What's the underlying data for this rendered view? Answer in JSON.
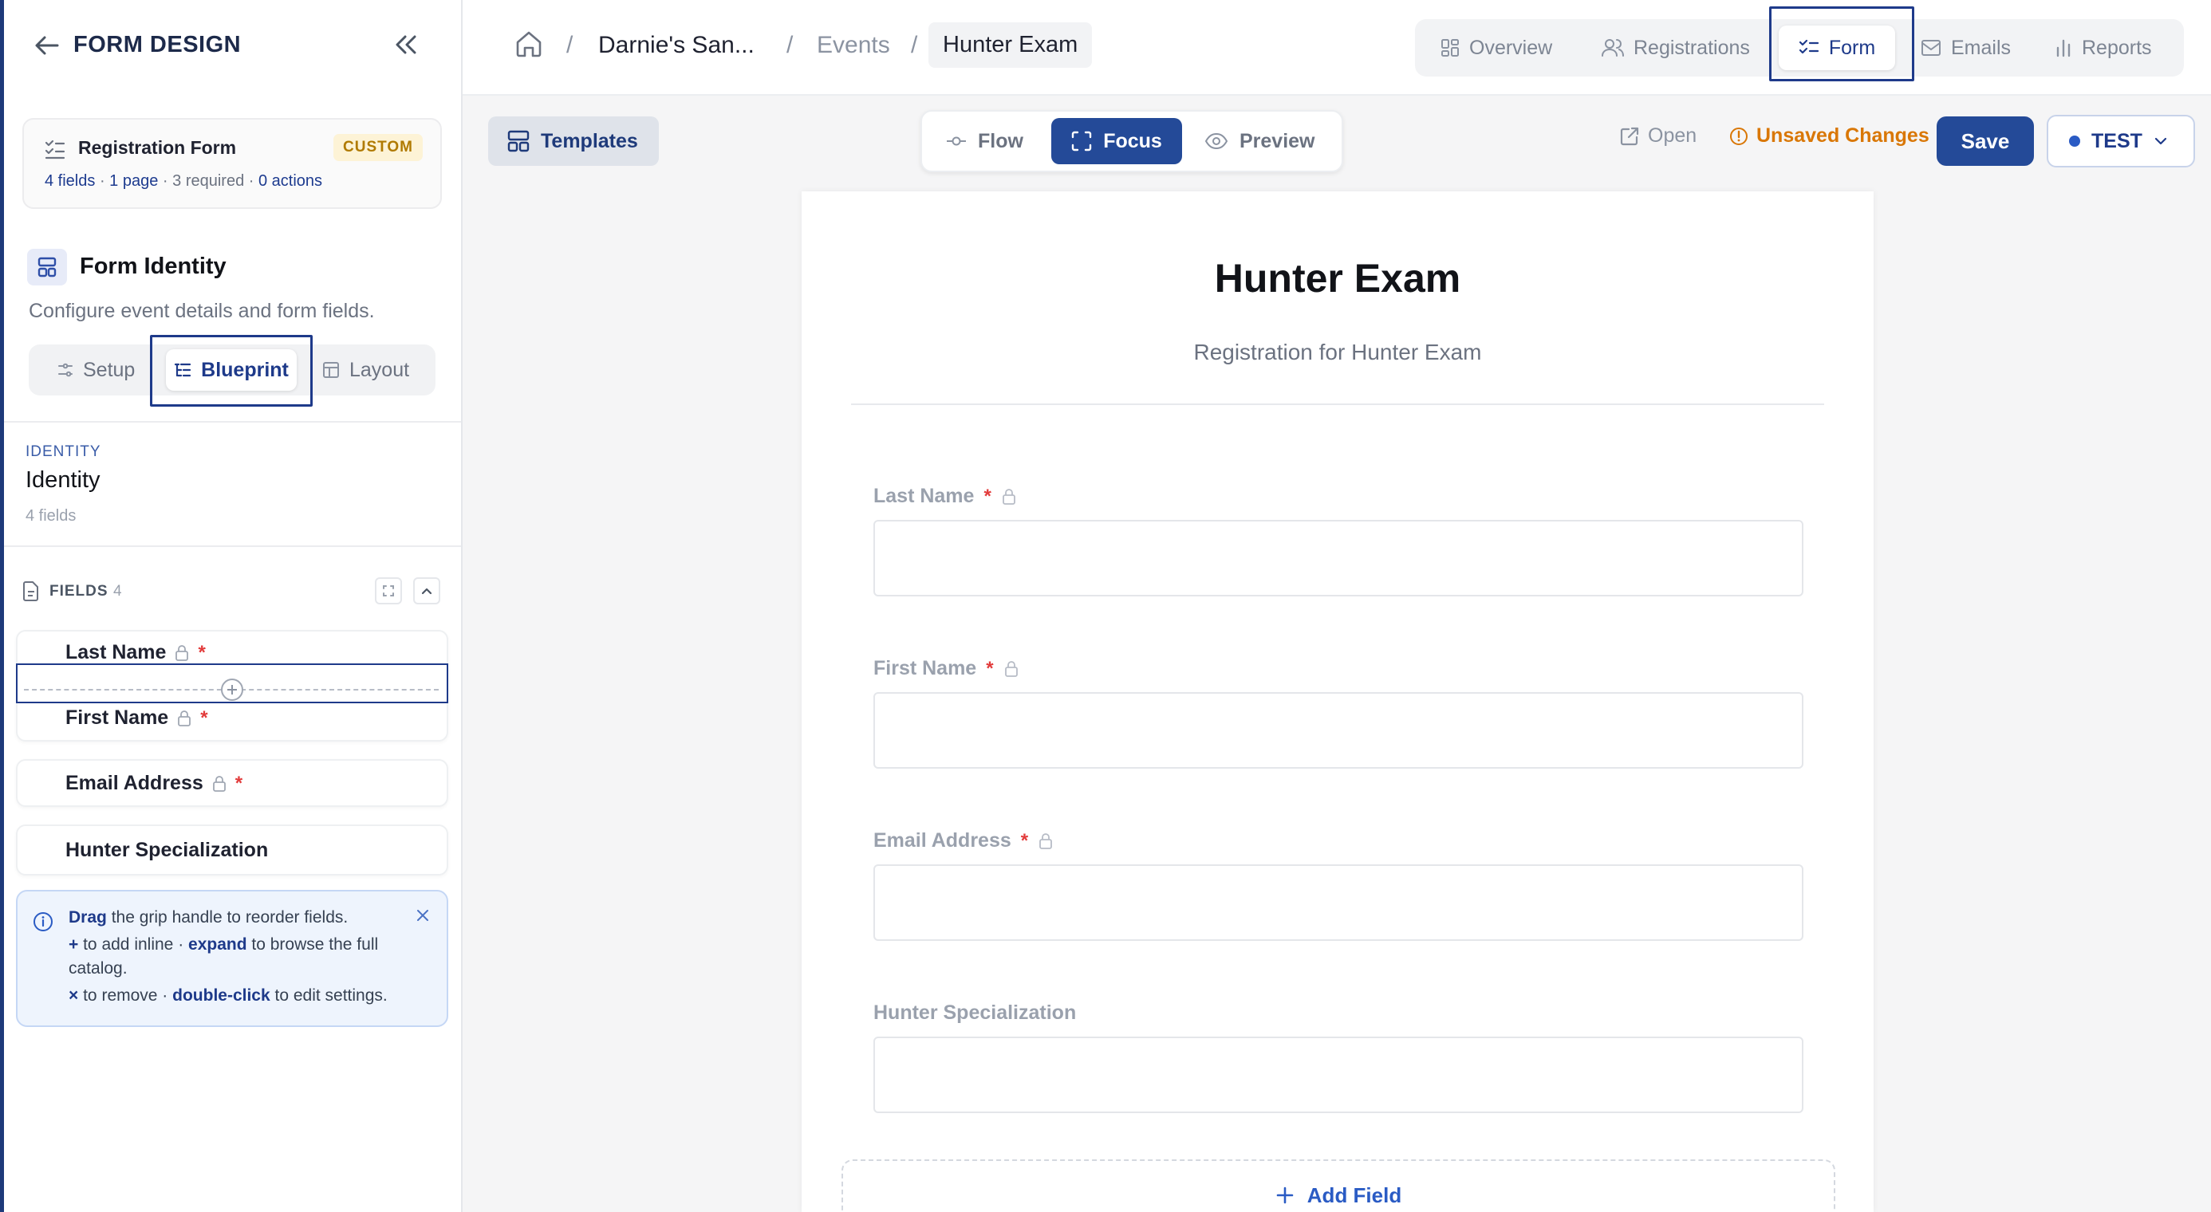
{
  "sidebar": {
    "title": "FORM DESIGN",
    "form_card": {
      "name": "Registration Form",
      "badge": "CUSTOM",
      "meta": {
        "fields": "4 fields",
        "pages": "1 page",
        "required": "3 required",
        "actions": "0 actions",
        "sep": "·"
      }
    },
    "identity_section": {
      "title": "Form Identity",
      "description": "Configure event details and form fields."
    },
    "tabs": [
      {
        "label": "Setup"
      },
      {
        "label": "Blueprint"
      },
      {
        "label": "Layout"
      }
    ],
    "identity": {
      "eyebrow": "IDENTITY",
      "name": "Identity",
      "count": "4 fields"
    },
    "fields_header": {
      "label": "FIELDS",
      "count": "4"
    },
    "fields": [
      {
        "label": "Last Name",
        "required": "*"
      },
      {
        "label": "First Name",
        "required": "*"
      },
      {
        "label": "Email Address",
        "required": "*"
      },
      {
        "label": "Hunter Specialization"
      }
    ],
    "tip": {
      "l1_b": "Drag",
      "l1": " the grip handle to reorder fields.",
      "l2_b1": "+",
      "l2_a": " to add inline · ",
      "l2_b2": "expand",
      "l2_c": " to browse the full",
      "l3": "catalog.",
      "l4_b1": "×",
      "l4_a": " to remove · ",
      "l4_b2": "double-click",
      "l4_c": " to edit settings."
    }
  },
  "breadcrumb": {
    "sep": "/",
    "items": [
      "Darnie's San...",
      "Events",
      "Hunter Exam"
    ]
  },
  "nav": [
    {
      "label": "Overview"
    },
    {
      "label": "Registrations"
    },
    {
      "label": "Form"
    },
    {
      "label": "Emails"
    },
    {
      "label": "Reports"
    }
  ],
  "toolbar": {
    "templates": "Templates",
    "modes": [
      {
        "label": "Flow"
      },
      {
        "label": "Focus"
      },
      {
        "label": "Preview"
      }
    ],
    "open": "Open",
    "unsaved": "Unsaved Changes",
    "save": "Save",
    "env": "TEST"
  },
  "form": {
    "title": "Hunter Exam",
    "subtitle": "Registration for Hunter Exam",
    "fields": [
      {
        "label": "Last Name",
        "required": "*"
      },
      {
        "label": "First Name",
        "required": "*"
      },
      {
        "label": "Email Address",
        "required": "*"
      },
      {
        "label": "Hunter Specialization"
      }
    ],
    "add_field": "Add Field"
  },
  "colors": {
    "primary": "#244a98",
    "highlight": "#1e3a8a",
    "warning": "#d97706",
    "required": "#e23b3b",
    "badge_bg": "#fdf3d6"
  }
}
